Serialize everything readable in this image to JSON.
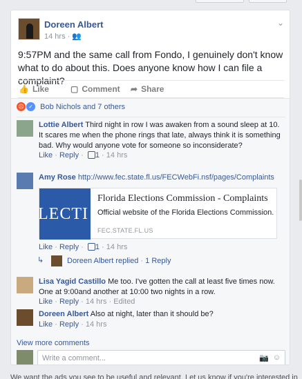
{
  "post": {
    "author": "Doreen Albert",
    "time": "14 hrs",
    "audience_icon": "friends-icon",
    "text": "9:57PM and the same call from Fondo, I genuinely don't know what to do about this. Does anyone know how I can file a complaint?",
    "actions": {
      "like": "Like",
      "comment": "Comment",
      "share": "Share"
    },
    "reactions": {
      "label": "Bob Nichols and 7 others",
      "types": [
        "angry",
        "like"
      ]
    }
  },
  "comments": [
    {
      "author": "Lottie Albert",
      "text": "Third night in row I was awaken from a sound sleep at 10. It scares me when the phone rings that late, always think it is something bad. Why would anyone vote for someone so inconsiderate?",
      "like": "Like",
      "reply": "Reply",
      "likes": "1",
      "time": "14 hrs"
    },
    {
      "author": "Amy Rose",
      "text": "http://www.fec.state.fl.us/FECWebFi.nsf/pages/Complaints",
      "preview": {
        "image_text": "LECTI",
        "title": "Florida Elections Commission - Complaints",
        "description": "Official website of the Florida Elections Commission.",
        "domain": "FEC.STATE.FL.US"
      },
      "like": "Like",
      "reply": "Reply",
      "likes": "1",
      "time": "14 hrs",
      "reply_summary": {
        "author": "Doreen Albert",
        "action": "replied",
        "count": "1 Reply"
      }
    },
    {
      "author": "Lisa Yagid Castillo",
      "text": "Me too. I've gotten the call at least five times now. One at 9:00and another at 10:00 two nights in a row.",
      "like": "Like",
      "reply": "Reply",
      "time": "14 hrs",
      "edited": "Edited"
    },
    {
      "author": "Doreen Albert",
      "text": "Also at night, later than it should be?",
      "like": "Like",
      "reply": "Reply",
      "time": "14 hrs"
    }
  ],
  "view_more": "View more comments",
  "composer": {
    "placeholder": "Write a comment..."
  },
  "footer": "We want the ads you see to be useful and relevant. Let us know if you're interested in",
  "colors": {
    "link": "#365899",
    "muted": "#90949c",
    "background": "#e9ebee"
  }
}
